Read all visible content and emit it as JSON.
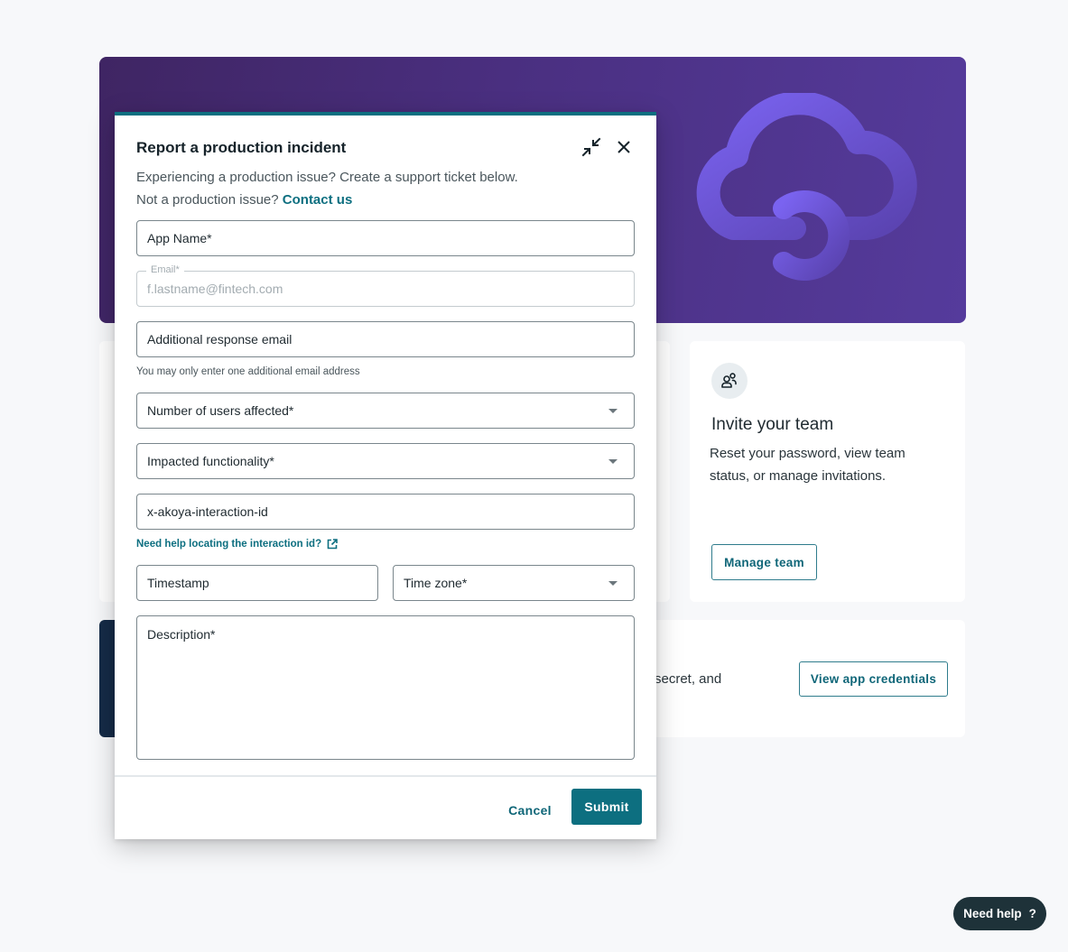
{
  "background": {
    "team_card": {
      "title": "Invite your team",
      "description": "Reset your password, view team status, or manage invitations.",
      "button": "Manage team"
    },
    "credentials_card": {
      "partial_text": "secret, and",
      "button": "View app credentials"
    },
    "colors": {
      "hero_start": "#3f2563",
      "hero_end": "#553b9c",
      "cloud": "#7460e6"
    }
  },
  "modal": {
    "title": "Report a production incident",
    "subtitle_line1": "Experiencing a production issue? Create a support ticket below.",
    "subtitle_line2_prefix": "Not a production issue?",
    "contact_link": "Contact us",
    "fields": {
      "app_name": "App Name*",
      "email_label": "Email*",
      "email_value": "f.lastname@fintech.com",
      "additional_email": "Additional response email",
      "additional_email_helper": "You may only enter one additional email address",
      "users_affected": "Number of users affected*",
      "impacted_functionality": "Impacted functionality*",
      "interaction_id": "x-akoya-interaction-id",
      "interaction_help_link": "Need help locating the interaction id?",
      "timestamp": "Timestamp",
      "time_zone": "Time zone*",
      "description": "Description*"
    },
    "actions": {
      "cancel": "Cancel",
      "submit": "Submit"
    },
    "accent_color": "#0d6f80"
  },
  "need_help": {
    "label": "Need help",
    "icon": "?"
  }
}
